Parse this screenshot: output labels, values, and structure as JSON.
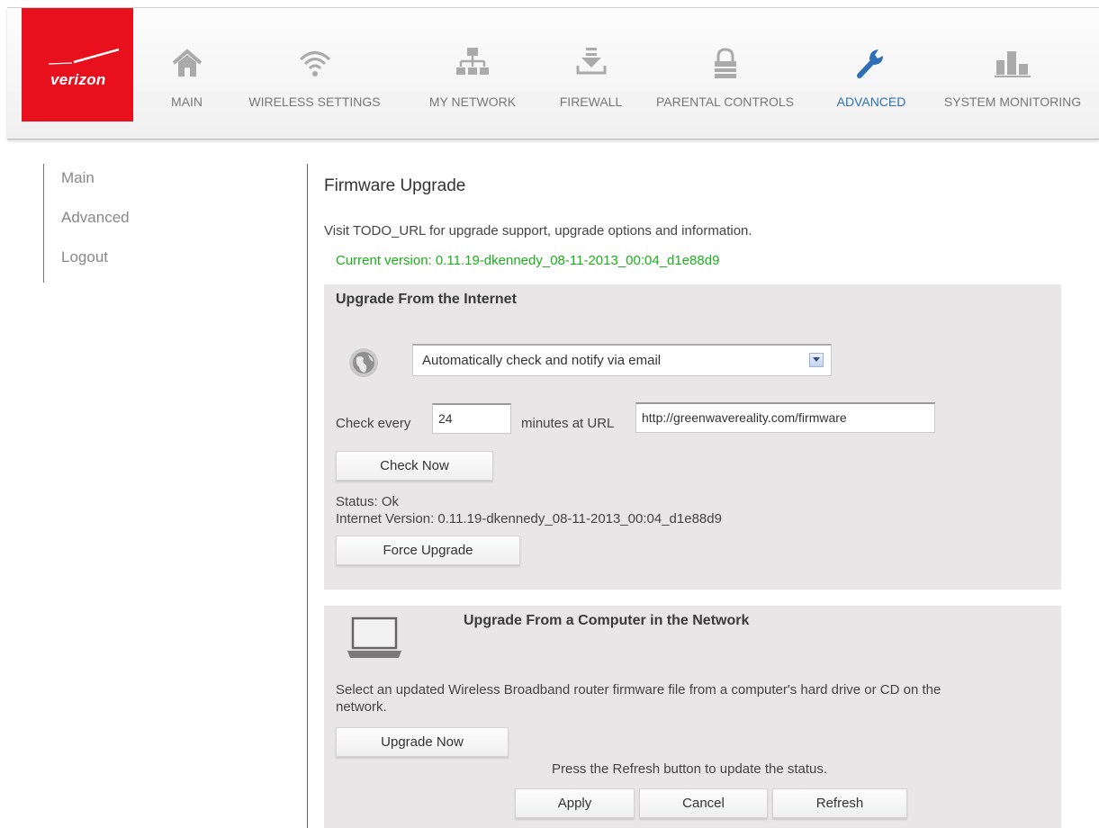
{
  "brand": {
    "name": "verizon",
    "color": "#e8101d"
  },
  "nav": {
    "items": [
      {
        "label": "MAIN",
        "icon": "home-icon"
      },
      {
        "label": "WIRELESS SETTINGS",
        "icon": "wifi-icon"
      },
      {
        "label": "MY NETWORK",
        "icon": "network-icon"
      },
      {
        "label": "FIREWALL",
        "icon": "firewall-icon"
      },
      {
        "label": "PARENTAL CONTROLS",
        "icon": "lock-icon"
      },
      {
        "label": "ADVANCED",
        "icon": "wrench-icon",
        "active": true
      },
      {
        "label": "SYSTEM MONITORING",
        "icon": "bar-chart-icon"
      }
    ],
    "active_color": "#2e70b5"
  },
  "sidebar": {
    "items": [
      {
        "label": "Main"
      },
      {
        "label": "Advanced"
      },
      {
        "label": "Logout"
      }
    ]
  },
  "page": {
    "title": "Firmware Upgrade",
    "visit_text": "Visit TODO_URL for upgrade support, upgrade options and information.",
    "current_version": "Current version: 0.11.19-dkennedy_08-11-2013_00:04_d1e88d9"
  },
  "internet_upgrade": {
    "title": "Upgrade From the Internet",
    "mode_selected": "Automatically check and notify via email",
    "check_every_label": "Check every",
    "check_every_value": "24",
    "minutes_label": "minutes at URL",
    "url_value": "http://greenwavereality.com/firmware",
    "check_now_label": "Check Now",
    "status": "Status: Ok",
    "internet_version": "Internet Version: 0.11.19-dkennedy_08-11-2013_00:04_d1e88d9",
    "force_upgrade_label": "Force Upgrade"
  },
  "computer_upgrade": {
    "title": "Upgrade From a Computer in the Network",
    "description_line1": "Select an updated Wireless Broadband router firmware file from a computer's hard drive or CD on the",
    "description_line2": "network.",
    "upgrade_now_label": "Upgrade Now",
    "refresh_hint": "Press the Refresh button to update the status."
  },
  "footer_buttons": {
    "apply": "Apply",
    "cancel": "Cancel",
    "refresh": "Refresh"
  }
}
